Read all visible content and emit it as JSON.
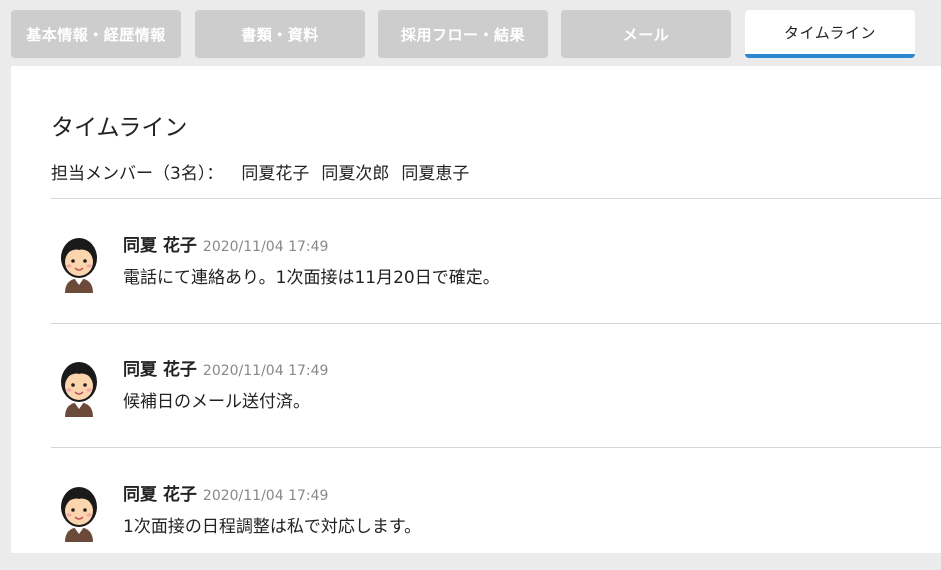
{
  "tabs": [
    {
      "label": "基本情報・経歴情報",
      "active": false
    },
    {
      "label": "書類・資料",
      "active": false
    },
    {
      "label": "採用フロー・結果",
      "active": false
    },
    {
      "label": "メール",
      "active": false
    },
    {
      "label": "タイムライン",
      "active": true
    }
  ],
  "colors": {
    "accent": "#2c87d2",
    "tab_inactive": "#cdcdcd",
    "page_bg": "#ebebeb"
  },
  "timeline": {
    "title": "タイムライン",
    "members_label": "担当メンバー（3名）：",
    "members": [
      "同夏花子",
      "同夏次郎",
      "同夏恵子"
    ],
    "entries": [
      {
        "author": "同夏 花子",
        "timestamp": "2020/11/04 17:49",
        "message": "電話にて連絡あり。1次面接は11月20日で確定。"
      },
      {
        "author": "同夏 花子",
        "timestamp": "2020/11/04 17:49",
        "message": "候補日のメール送付済。"
      },
      {
        "author": "同夏 花子",
        "timestamp": "2020/11/04 17:49",
        "message": "1次面接の日程調整は私で対応します。"
      }
    ]
  }
}
